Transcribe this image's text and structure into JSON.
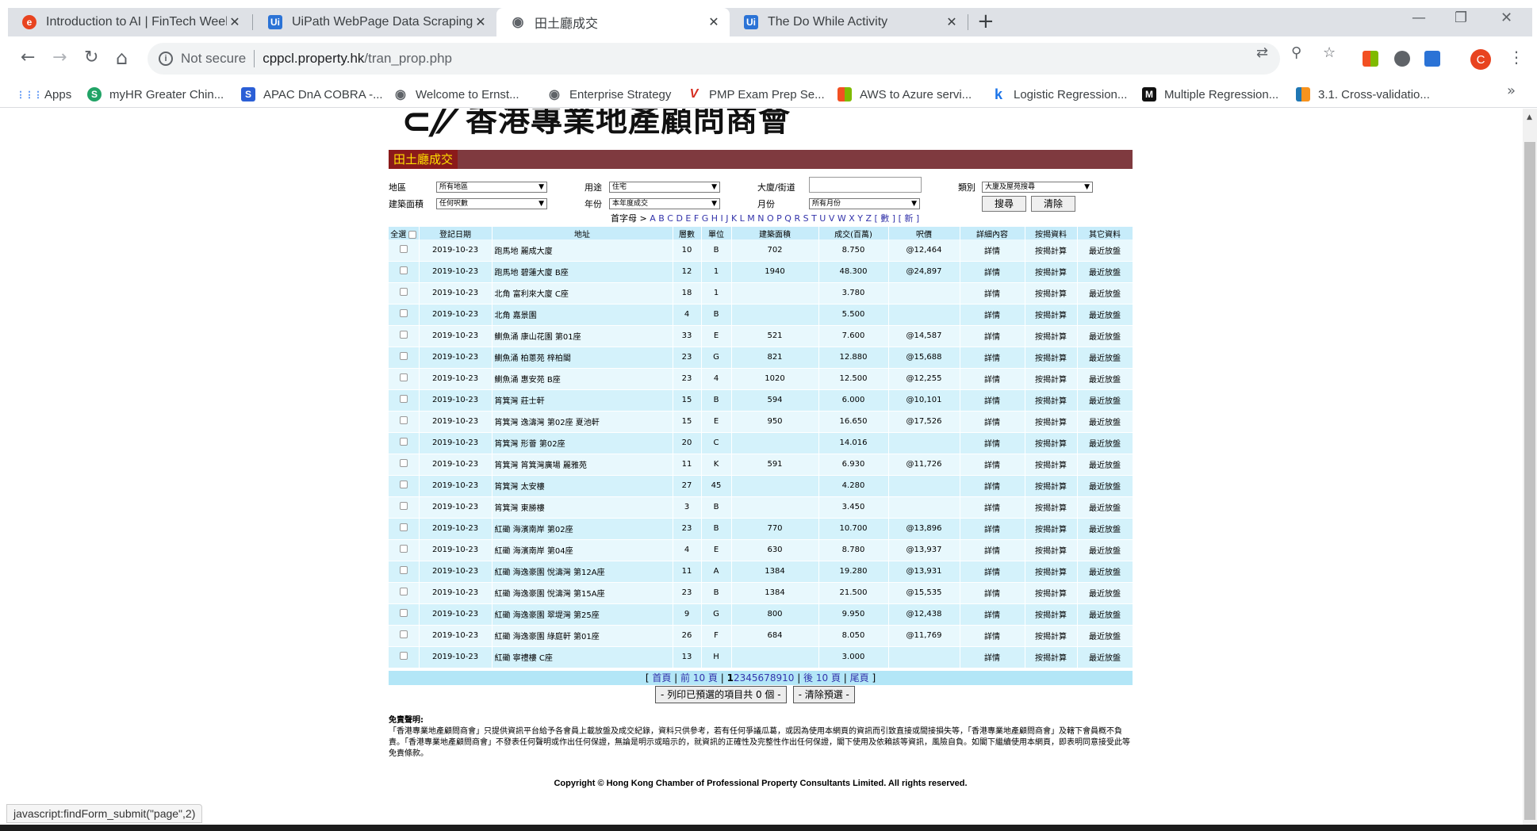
{
  "browser": {
    "tabs": [
      {
        "title": "Introduction to AI | FinTech Week",
        "icon": "edge-e-icon",
        "color": "#e8431f",
        "glyph": "e"
      },
      {
        "title": "UiPath WebPage Data Scraping :",
        "icon": "uipath-icon",
        "color": "#2b73d6",
        "glyph": "Ui"
      },
      {
        "title": "田土廳成交",
        "icon": "globe-icon",
        "color": "#5f6368",
        "glyph": "◉"
      },
      {
        "title": "The Do While Activity",
        "icon": "uipath-icon",
        "color": "#2b73d6",
        "glyph": "Ui"
      }
    ],
    "new_tab": "+",
    "window": {
      "minimize": "—",
      "restore": "❐",
      "close": "✕"
    },
    "nav": {
      "back": "←",
      "forward": "→",
      "reload": "↻",
      "home": "⌂"
    },
    "address": {
      "security": "Not secure",
      "host": "cppcl.property.hk",
      "path": "/tran_prop.php"
    },
    "profile_initial": "C",
    "bookmarks": [
      {
        "label": "Apps",
        "color": "#4285f4",
        "glyph": "⋮⋮"
      },
      {
        "label": "myHR Greater Chin...",
        "color": "#21a366",
        "glyph": "S"
      },
      {
        "label": "APAC DnA COBRA -...",
        "color": "#2b5fd6",
        "glyph": "S"
      },
      {
        "label": "Welcome to Ernst...",
        "color": "#5f6368",
        "glyph": "◉"
      },
      {
        "label": "Enterprise Strategy",
        "color": "#5f6368",
        "glyph": "◉"
      },
      {
        "label": "PMP Exam Prep Se...",
        "color": "#d62d20",
        "glyph": "V"
      },
      {
        "label": "AWS to Azure servi...",
        "color": "#f25022",
        "glyph": "▦"
      },
      {
        "label": "Logistic Regression...",
        "color": "#1a73e8",
        "glyph": "k"
      },
      {
        "label": "Multiple Regression...",
        "color": "#111111",
        "glyph": "M"
      },
      {
        "label": "3.1. Cross-validatio...",
        "color": "#f7931e",
        "glyph": "▮"
      }
    ],
    "bookmarks_more": "»",
    "status_text": "javascript:findForm_submit(\"page\",2)"
  },
  "site": {
    "logo_text": "香港專業地產顧問商會",
    "section_title": "田土廳成交",
    "filters": {
      "district_label": "地區",
      "district_value": "所有地區",
      "usage_label": "用途",
      "usage_value": "住宅",
      "building_label": "大廈/街道",
      "building_value": "",
      "category_label": "類別",
      "category_value": "大廈及屋苑搜尋",
      "area_label": "建築面積",
      "area_value": "任何呎數",
      "year_label": "年份",
      "year_value": "本年度成交",
      "month_label": "月份",
      "month_value": "所有月份",
      "search_button": "搜尋",
      "clear_button": "清除"
    },
    "alpha_prefix": "首字母 >",
    "alpha_letters": "A B C D E F G H I J K L M N O P Q R S T U V W X Y Z",
    "alpha_suffix": "[ 數 ] [ 新 ]",
    "table": {
      "headers": [
        "全選",
        "登記日期",
        "地址",
        "層數",
        "單位",
        "建築面積",
        "成交(百萬)",
        "呎價",
        "詳細內容",
        "按揭資料",
        "其它資料"
      ],
      "detail_link": "詳情",
      "mortgage_link": "按揭計算",
      "recent_link": "最近放盤",
      "rows": [
        {
          "date": "2019-10-23",
          "address": "跑馬地 麗成大廈",
          "floor": "10",
          "unit": "B",
          "area": "702",
          "price": "8.750",
          "psf": "@12,464"
        },
        {
          "date": "2019-10-23",
          "address": "跑馬地 碧蓮大廈 B座",
          "floor": "12",
          "unit": "1",
          "area": "1940",
          "price": "48.300",
          "psf": "@24,897"
        },
        {
          "date": "2019-10-23",
          "address": "北角 富利來大廈 C座",
          "floor": "18",
          "unit": "1",
          "area": "",
          "price": "3.780",
          "psf": ""
        },
        {
          "date": "2019-10-23",
          "address": "北角 嘉景園",
          "floor": "4",
          "unit": "B",
          "area": "",
          "price": "5.500",
          "psf": ""
        },
        {
          "date": "2019-10-23",
          "address": "鰂魚涌 康山花園 第01座",
          "floor": "33",
          "unit": "E",
          "area": "521",
          "price": "7.600",
          "psf": "@14,587"
        },
        {
          "date": "2019-10-23",
          "address": "鰂魚涌 柏蔥苑 梓柏閣",
          "floor": "23",
          "unit": "G",
          "area": "821",
          "price": "12.880",
          "psf": "@15,688"
        },
        {
          "date": "2019-10-23",
          "address": "鰂魚涌 惠安苑 B座",
          "floor": "23",
          "unit": "4",
          "area": "1020",
          "price": "12.500",
          "psf": "@12,255"
        },
        {
          "date": "2019-10-23",
          "address": "筲箕灣 莊士軒",
          "floor": "15",
          "unit": "B",
          "area": "594",
          "price": "6.000",
          "psf": "@10,101"
        },
        {
          "date": "2019-10-23",
          "address": "筲箕灣 逸濤灣 第02座 夏池軒",
          "floor": "15",
          "unit": "E",
          "area": "950",
          "price": "16.650",
          "psf": "@17,526"
        },
        {
          "date": "2019-10-23",
          "address": "筲箕灣 形薈 第02座",
          "floor": "20",
          "unit": "C",
          "area": "",
          "price": "14.016",
          "psf": ""
        },
        {
          "date": "2019-10-23",
          "address": "筲箕灣 筲箕灣廣場 麗雅苑",
          "floor": "11",
          "unit": "K",
          "area": "591",
          "price": "6.930",
          "psf": "@11,726"
        },
        {
          "date": "2019-10-23",
          "address": "筲箕灣 太安樓",
          "floor": "27",
          "unit": "45",
          "area": "",
          "price": "4.280",
          "psf": ""
        },
        {
          "date": "2019-10-23",
          "address": "筲箕灣 東勝樓",
          "floor": "3",
          "unit": "B",
          "area": "",
          "price": "3.450",
          "psf": ""
        },
        {
          "date": "2019-10-23",
          "address": "紅磡 海濱南岸 第02座",
          "floor": "23",
          "unit": "B",
          "area": "770",
          "price": "10.700",
          "psf": "@13,896"
        },
        {
          "date": "2019-10-23",
          "address": "紅磡 海濱南岸 第04座",
          "floor": "4",
          "unit": "E",
          "area": "630",
          "price": "8.780",
          "psf": "@13,937"
        },
        {
          "date": "2019-10-23",
          "address": "紅磡 海逸豪園 悅濤灣 第12A座",
          "floor": "11",
          "unit": "A",
          "area": "1384",
          "price": "19.280",
          "psf": "@13,931"
        },
        {
          "date": "2019-10-23",
          "address": "紅磡 海逸豪園 悅濤灣 第15A座",
          "floor": "23",
          "unit": "B",
          "area": "1384",
          "price": "21.500",
          "psf": "@15,535"
        },
        {
          "date": "2019-10-23",
          "address": "紅磡 海逸豪園 翠堤灣 第25座",
          "floor": "9",
          "unit": "G",
          "area": "800",
          "price": "9.950",
          "psf": "@12,438"
        },
        {
          "date": "2019-10-23",
          "address": "紅磡 海逸豪園 綠庭軒 第01座",
          "floor": "26",
          "unit": "F",
          "area": "684",
          "price": "8.050",
          "psf": "@11,769"
        },
        {
          "date": "2019-10-23",
          "address": "紅磡 寧禮樓 C座",
          "floor": "13",
          "unit": "H",
          "area": "",
          "price": "3.000",
          "psf": ""
        }
      ]
    },
    "pager": {
      "first": "首頁",
      "prev": "前 10 頁",
      "current": "1",
      "pages": [
        "2",
        "3",
        "4",
        "5",
        "6",
        "7",
        "8",
        "9",
        "10"
      ],
      "next": "後 10 頁",
      "last": "尾頁"
    },
    "print_button": "- 列印已預選的項目共 0 個 -",
    "clear_selection_button": "- 清除預選 -",
    "disclaimer_title": "免責聲明:",
    "disclaimer_text": "「香港專業地產顧問商會」只提供資訊平台給予各會員上載放盤及成交紀錄，資料只供參考，若有任何爭議瓜葛，或因為使用本網頁的資訊而引致直接或間接損失等，「香港專業地產顧問商會」及轄下會員概不負責。「香港專業地產顧問商會」不發表任何聲明或作出任何保證，無論是明示或暗示的，就資訊的正確性及完整性作出任何保證，閣下使用及依賴該等資訊，風險自負。如閣下繼續使用本網頁，即表明同意接受此等免責條款。",
    "copyright": "Copyright © Hong Kong Chamber of Professional Property Consultants Limited. All rights reserved."
  }
}
